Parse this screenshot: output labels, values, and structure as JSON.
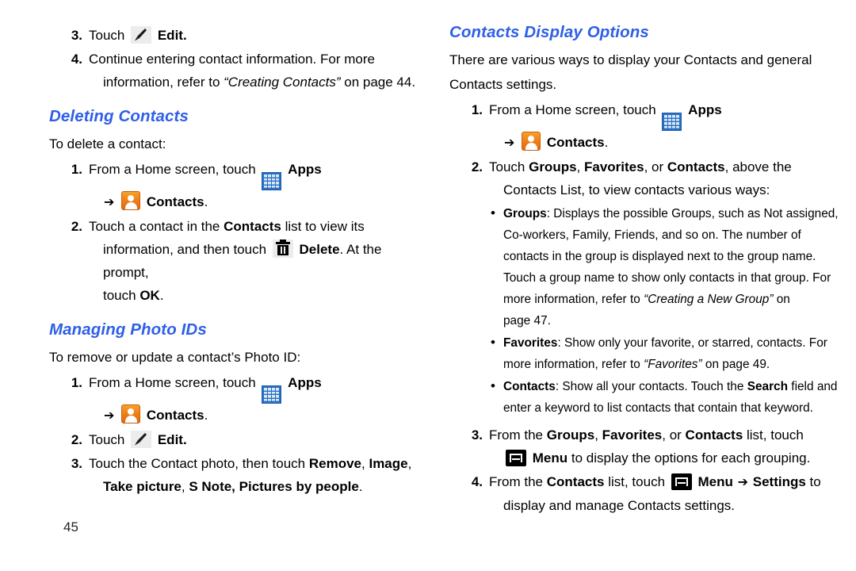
{
  "page": {
    "folio": "45",
    "heading_color": "#2d5fe8"
  },
  "icons": {
    "edit": "pencil-icon",
    "apps": "apps-grid-icon",
    "contacts": "contacts-person-icon",
    "delete": "trash-icon",
    "menu": "menu-key-icon",
    "arrow": "➔",
    "bullet": "•"
  },
  "left_column": {
    "steps_top": [
      {
        "num": "3.",
        "text_before": "Touch",
        "icon": "edit",
        "text_after": "Edit."
      },
      {
        "num": "4.",
        "line1": "Continue entering contact information. For more",
        "line2_a": "information, refer to ",
        "line2_ref": "“Creating Contacts”",
        "line2_b": " on page 44."
      }
    ],
    "section_deleting": {
      "heading": "Deleting Contacts",
      "intro": "To delete a contact:",
      "step1": {
        "num": "1.",
        "text_before": "From a Home screen, touch",
        "icon_apps": "apps",
        "apps_label": "Apps",
        "arrow": "➔",
        "icon_contacts": "contacts",
        "contacts_label": "Contacts",
        "period": "."
      },
      "step2": {
        "num": "2.",
        "line1_a": "Touch a contact in the ",
        "line1_b": "Contacts",
        "line1_c": " list to view its",
        "line2_a": "information, and then touch",
        "line2_icon": "delete",
        "line2_b": "Delete",
        "line2_c": ". At the prompt,",
        "line3_a": "touch ",
        "line3_b": "OK",
        "line3_c": "."
      }
    },
    "section_photo_ids": {
      "heading": "Managing Photo IDs",
      "intro": "To remove or update a contact’s Photo ID:",
      "step1": {
        "num": "1.",
        "text_before": "From a Home screen, touch",
        "icon_apps": "apps",
        "apps_label": "Apps",
        "arrow": "➔",
        "icon_contacts": "contacts",
        "contacts_label": "Contacts",
        "period": "."
      },
      "step2": {
        "num": "2.",
        "text_before": "Touch",
        "icon": "edit",
        "text_after": "Edit."
      },
      "step3": {
        "num": "3.",
        "line1_a": "Touch the Contact photo, then touch ",
        "line1_b": "Remove",
        "line1_c": ", ",
        "line1_d": "Image",
        "line1_e": ",",
        "line2_a": "Take picture",
        "line2_b": ", ",
        "line2_c": "S Note, Pictures by people",
        "line2_d": "."
      }
    }
  },
  "right_column": {
    "heading": "Contacts Display Options",
    "intro_line1": "There are various ways to display your Contacts and general",
    "intro_line2": "Contacts settings.",
    "step1": {
      "num": "1.",
      "text_before": "From a Home screen, touch",
      "icon_apps": "apps",
      "apps_label": "Apps",
      "arrow": "➔",
      "icon_contacts": "contacts",
      "contacts_label": "Contacts",
      "period": "."
    },
    "step2": {
      "num": "2.",
      "line1_a": "Touch ",
      "line1_b": "Groups",
      "line1_c": ", ",
      "line1_d": "Favorites",
      "line1_e": ", or ",
      "line1_f": "Contacts",
      "line1_g": ", above the",
      "line2": "Contacts List, to view contacts various ways:"
    },
    "bullets": [
      {
        "label": "Groups",
        "lines": [
          {
            "text": ": Displays the possible Groups, such as Not assigned,"
          },
          {
            "text": "Co-workers, Family, Friends, and so on. The number of"
          },
          {
            "text": "contacts in the group is displayed next to the group name."
          },
          {
            "text": "Touch a group name to show only contacts in that group. For"
          },
          {
            "text": "more information, refer to ",
            "ref": "“Creating a New Group”",
            "tail": " on"
          },
          {
            "text": "page 47."
          }
        ]
      },
      {
        "label": "Favorites",
        "lines": [
          {
            "text": ": Show only your favorite, or starred, contacts. For"
          },
          {
            "text": "more information, refer to ",
            "ref": "“Favorites”",
            "tail": " on page 49."
          }
        ]
      },
      {
        "label": "Contacts",
        "lines": [
          {
            "text": ": Show all your contacts. Touch the ",
            "bold": "Search",
            "tail": " field and"
          },
          {
            "text": "enter a keyword to list contacts that contain that keyword."
          }
        ]
      }
    ],
    "step3": {
      "num": "3.",
      "line1_a": "From the ",
      "line1_b": "Groups",
      "line1_c": ", ",
      "line1_d": "Favorites",
      "line1_e": ", or ",
      "line1_f": "Contacts",
      "line1_g": " list, touch",
      "line2_icon": "menu",
      "line2_a": "Menu",
      "line2_b": " to display the options for each grouping."
    },
    "step4": {
      "num": "4.",
      "line1_a": "From the ",
      "line1_b": "Contacts",
      "line1_c": " list, touch",
      "line1_icon": "menu",
      "line1_d": "Menu",
      "line1_arrow": "➔",
      "line1_e": "Settings",
      "line1_f": " to",
      "line2": "display and manage Contacts settings."
    }
  }
}
